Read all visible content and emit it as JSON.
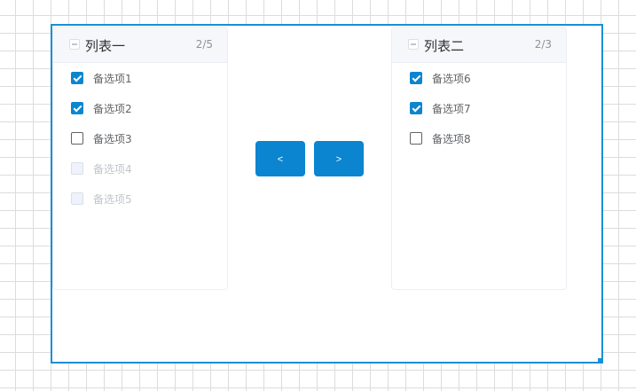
{
  "left_panel": {
    "title": "列表一",
    "count": "2/5",
    "items": [
      {
        "label": "备选项1",
        "checked": true,
        "disabled": false
      },
      {
        "label": "备选项2",
        "checked": true,
        "disabled": false
      },
      {
        "label": "备选项3",
        "checked": false,
        "disabled": false
      },
      {
        "label": "备选项4",
        "checked": false,
        "disabled": true
      },
      {
        "label": "备选项5",
        "checked": false,
        "disabled": true
      }
    ]
  },
  "right_panel": {
    "title": "列表二",
    "count": "2/3",
    "items": [
      {
        "label": "备选项6",
        "checked": true,
        "disabled": false
      },
      {
        "label": "备选项7",
        "checked": true,
        "disabled": false
      },
      {
        "label": "备选项8",
        "checked": false,
        "disabled": false
      }
    ]
  },
  "buttons": {
    "to_left_label": "<",
    "to_right_label": ">"
  },
  "colors": {
    "accent": "#0b85d0",
    "selection_border": "#1a8fd6",
    "disabled_text": "#c0c4cc"
  },
  "icons": {
    "header_check": "indeterminate-checkbox-icon",
    "selection_handle": "resize-handle-icon"
  }
}
